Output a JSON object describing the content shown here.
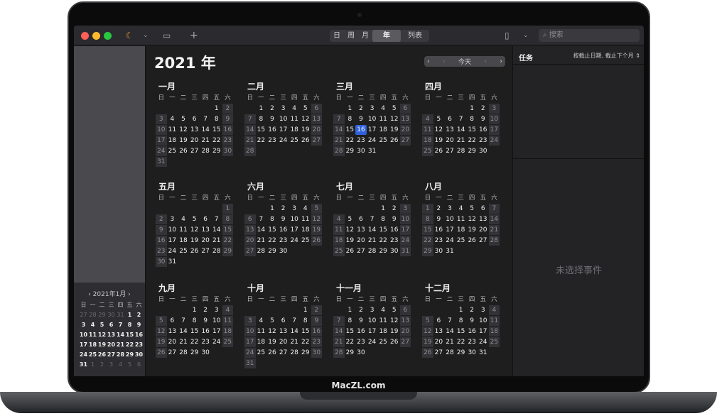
{
  "brand": "MacZL.com",
  "toolbar": {
    "segments": [
      "日",
      "周",
      "月",
      "年",
      "列表"
    ],
    "active_segment": "年",
    "search_placeholder": "搜索",
    "add": "+"
  },
  "main": {
    "year_title": "2021 年",
    "nav": {
      "prev": "‹",
      "prev2": "‹",
      "today": "今天",
      "next2": "›",
      "next": "›"
    }
  },
  "weekdays": [
    "日",
    "一",
    "二",
    "三",
    "四",
    "五",
    "六"
  ],
  "months": [
    {
      "name": "一月",
      "offset": 5,
      "days": 31
    },
    {
      "name": "二月",
      "offset": 1,
      "days": 28
    },
    {
      "name": "三月",
      "offset": 1,
      "days": 31,
      "today": 16
    },
    {
      "name": "四月",
      "offset": 4,
      "days": 30
    },
    {
      "name": "五月",
      "offset": 6,
      "days": 31
    },
    {
      "name": "六月",
      "offset": 2,
      "days": 30
    },
    {
      "name": "七月",
      "offset": 4,
      "days": 31
    },
    {
      "name": "八月",
      "offset": 0,
      "days": 31
    },
    {
      "name": "九月",
      "offset": 3,
      "days": 30
    },
    {
      "name": "十月",
      "offset": 5,
      "days": 31
    },
    {
      "name": "十一月",
      "offset": 1,
      "days": 30
    },
    {
      "name": "十二月",
      "offset": 3,
      "days": 31
    }
  ],
  "mini": {
    "title": "‹  2021年1月  ›",
    "prev_days": [
      27,
      28,
      29,
      30,
      31
    ],
    "days": 31,
    "next_days": [
      1,
      2,
      3,
      4,
      5,
      6
    ]
  },
  "right": {
    "tasks_title": "任务",
    "sort_label": "按截止日期, 截止下个月 ⇕",
    "no_event": "未选择事件"
  },
  "colors": {
    "accent": "#2f62d9",
    "red": "#fe5f57",
    "yellow": "#febc2e",
    "green": "#28c840"
  }
}
